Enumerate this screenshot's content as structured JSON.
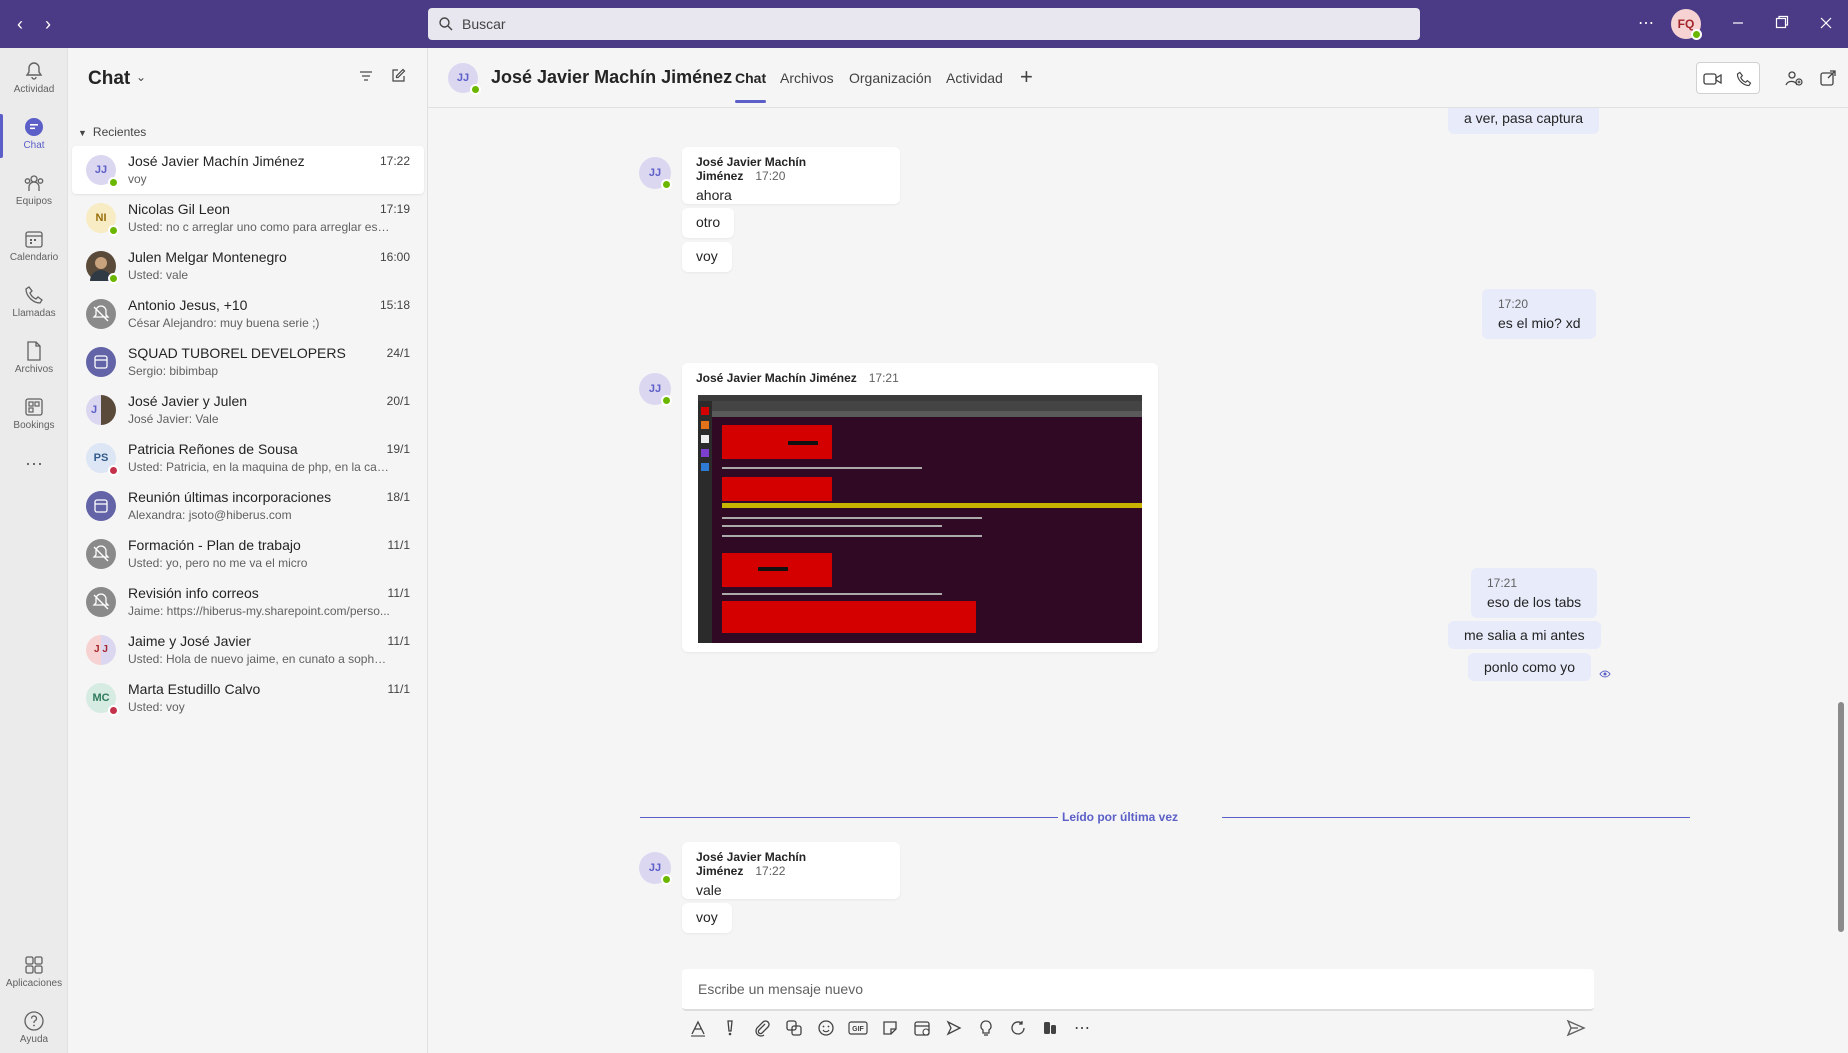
{
  "search": {
    "placeholder": "Buscar"
  },
  "me": {
    "initials": "FQ"
  },
  "rail": [
    {
      "label": "Actividad",
      "icon": "bell-icon"
    },
    {
      "label": "Chat",
      "icon": "chat-icon"
    },
    {
      "label": "Equipos",
      "icon": "teams-icon"
    },
    {
      "label": "Calendario",
      "icon": "calendar-icon"
    },
    {
      "label": "Llamadas",
      "icon": "phone-icon"
    },
    {
      "label": "Archivos",
      "icon": "file-icon"
    },
    {
      "label": "Bookings",
      "icon": "bookings-icon"
    },
    {
      "label": "Aplicaciones",
      "icon": "apps-icon"
    },
    {
      "label": "Ayuda",
      "icon": "help-icon"
    }
  ],
  "chatpane": {
    "title": "Chat",
    "recent_header": "Recientes"
  },
  "chats": [
    {
      "name": "José Javier Machín Jiménez",
      "preview": "voy",
      "time": "17:22",
      "initials": "JJ"
    },
    {
      "name": "Nicolas Gil Leon",
      "preview": "Usted: no c arreglar uno como para arreglar eso...",
      "time": "17:19",
      "initials": "NI"
    },
    {
      "name": "Julen Melgar Montenegro",
      "preview": "Usted: vale",
      "time": "16:00",
      "initials": ""
    },
    {
      "name": "Antonio Jesus, +10",
      "preview": "César Alejandro: muy buena serie ;)",
      "time": "15:18",
      "initials": ""
    },
    {
      "name": "SQUAD TUBOREL DEVELOPERS",
      "preview": "Sergio: bibimbap",
      "time": "24/1",
      "initials": ""
    },
    {
      "name": "José Javier y Julen",
      "preview": "José Javier: Vale",
      "time": "20/1",
      "initials": "J"
    },
    {
      "name": "Patricia Reñones de Sousa",
      "preview": "Usted: Patricia, en la maquina de php, en la carp...",
      "time": "19/1",
      "initials": "PS"
    },
    {
      "name": "Reunión últimas incorporaciones",
      "preview": "Alexandra: jsoto@hiberus.com",
      "time": "18/1",
      "initials": ""
    },
    {
      "name": "Formación - Plan de trabajo",
      "preview": "Usted: yo, pero no me va el micro",
      "time": "11/1",
      "initials": ""
    },
    {
      "name": "Revisión info correos",
      "preview": "Jaime: https://hiberus-my.sharepoint.com/perso...",
      "time": "11/1",
      "initials": ""
    },
    {
      "name": "Jaime y José Javier",
      "preview": "Usted: Hola de nuevo jaime, en cunato a sophos,...",
      "time": "11/1",
      "initials": "J J"
    },
    {
      "name": "Marta Estudillo Calvo",
      "preview": "Usted: voy",
      "time": "11/1",
      "initials": "MC"
    }
  ],
  "conversation": {
    "initials": "JJ",
    "name": "José Javier Machín Jiménez",
    "tabs": [
      "Chat",
      "Archivos",
      "Organización",
      "Actividad"
    ],
    "sender": "José Javier Machín Jiménez",
    "m0": "a ver, pasa captura",
    "g1_time": "17:20",
    "g1_text": "ahora",
    "g1_b2": "otro",
    "g1_b3": "voy",
    "me1_time": "17:20",
    "me1_text": "es el mio? xd",
    "g2_time": "17:21",
    "me2_time": "17:21",
    "me2_text": "eso de los tabs",
    "me2_b2": "me salia a mi antes",
    "me2_b3": "ponlo como yo",
    "last_read": "Leído por última vez",
    "g3_time": "17:22",
    "g3_text": "vale",
    "g3_b2": "voy"
  },
  "compose": {
    "placeholder": "Escribe un mensaje nuevo"
  },
  "colors": {
    "titlebar": "#4b3b86",
    "accent": "#5b5fc7",
    "mine_bubble": "#e8ebfa",
    "online": "#6bb700",
    "busy": "#c4314b"
  }
}
